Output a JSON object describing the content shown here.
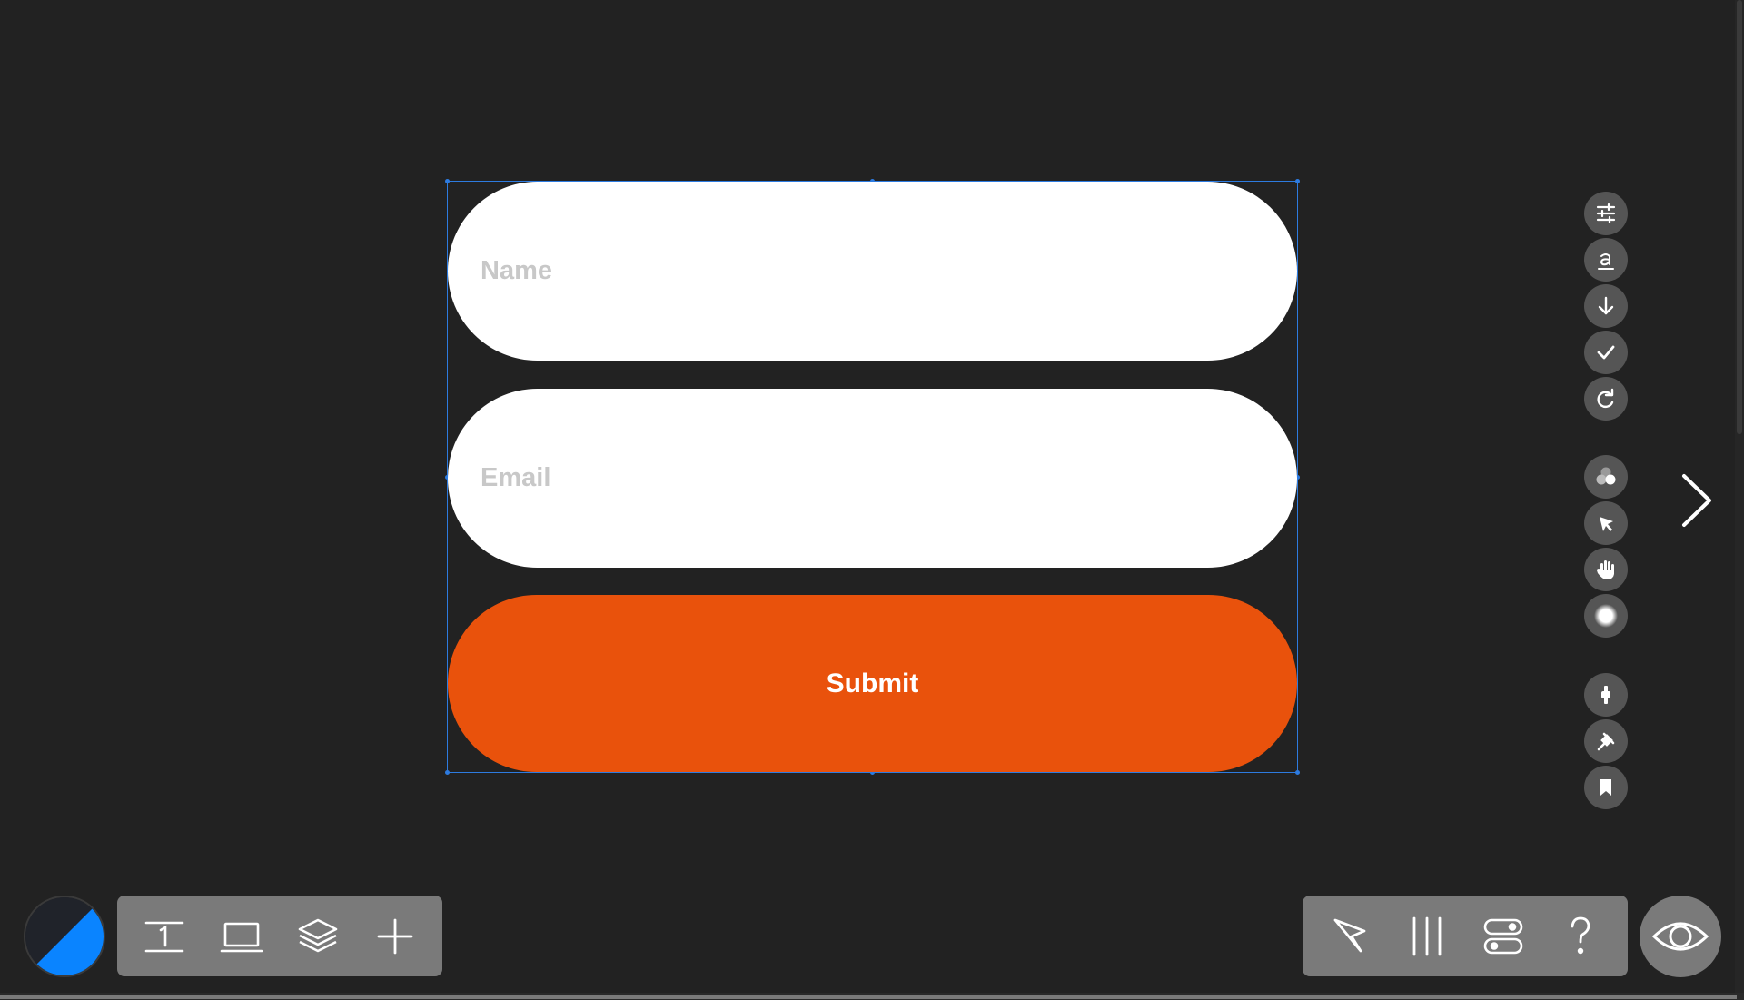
{
  "form": {
    "name_placeholder": "Name",
    "email_placeholder": "Email",
    "submit_label": "Submit"
  },
  "colors": {
    "canvas": "#222222",
    "selection": "#2d7be0",
    "input_bg": "#ffffff",
    "submit_bg": "#e9520c",
    "tool_bg": "#555555",
    "toolbar_bg": "#7a7a7a",
    "accent_blue": "#0a84ff"
  },
  "right_tools": [
    "sliders-icon",
    "text-underline-icon",
    "arrow-down-icon",
    "checkmark-icon",
    "redo-icon",
    "circles-icon",
    "cursor-arrow-icon",
    "hand-icon",
    "glow-icon",
    "plus-icon",
    "pin-icon",
    "bookmark-icon"
  ],
  "left_toolbar": [
    "text-tool-icon",
    "device-icon",
    "layers-icon",
    "add-icon"
  ],
  "right_toolbar": [
    "select-cursor-icon",
    "columns-icon",
    "toggles-icon",
    "help-icon"
  ]
}
